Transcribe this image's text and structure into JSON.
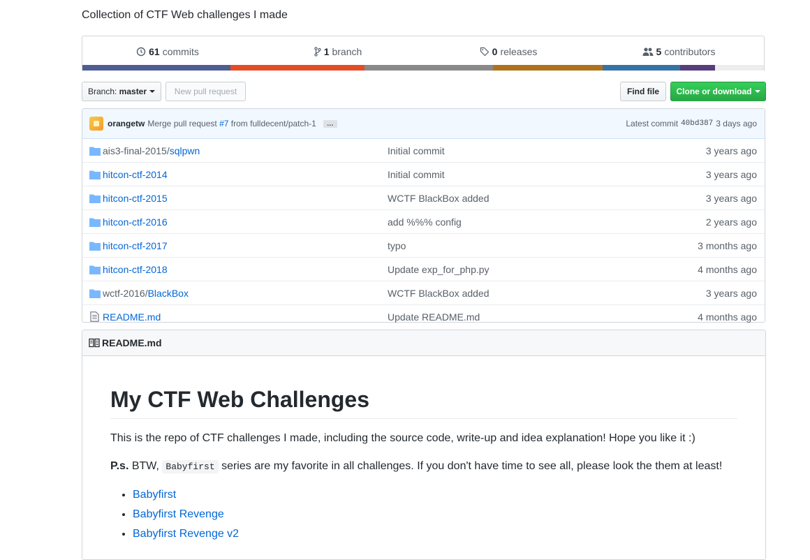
{
  "repo": {
    "description": "Collection of CTF Web challenges I made"
  },
  "stats": {
    "commits": {
      "count": "61",
      "label": "commits"
    },
    "branches": {
      "count": "1",
      "label": "branch"
    },
    "releases": {
      "count": "0",
      "label": "releases"
    },
    "contributors": {
      "count": "5",
      "label": "contributors"
    }
  },
  "language_colors": [
    "#4F5D95",
    "#e34c26",
    "#89898a",
    "#b07219",
    "#3572A5",
    "#563d7c",
    "#ededed"
  ],
  "toolbar": {
    "branch_prefix": "Branch:",
    "branch_name": "master",
    "new_pull_request": "New pull request",
    "find_file": "Find file",
    "clone_download": "Clone or download"
  },
  "latest_commit": {
    "author": "orangetw",
    "message_prefix": "Merge pull request",
    "pr_number": "#7",
    "message_suffix": "from fulldecent/patch-1",
    "ellipsis": "…",
    "latest_label": "Latest commit",
    "sha": "40bd387",
    "age": "3 days ago"
  },
  "files": [
    {
      "type": "dir",
      "path": "ais3-final-2015/",
      "name": "sqlpwn",
      "message": "Initial commit",
      "age": "3 years ago"
    },
    {
      "type": "dir",
      "path": "",
      "name": "hitcon-ctf-2014",
      "message": "Initial commit",
      "age": "3 years ago"
    },
    {
      "type": "dir",
      "path": "",
      "name": "hitcon-ctf-2015",
      "message": "WCTF BlackBox added",
      "age": "3 years ago"
    },
    {
      "type": "dir",
      "path": "",
      "name": "hitcon-ctf-2016",
      "message": "add %%% config",
      "age": "2 years ago"
    },
    {
      "type": "dir",
      "path": "",
      "name": "hitcon-ctf-2017",
      "message": "typo",
      "age": "3 months ago"
    },
    {
      "type": "dir",
      "path": "",
      "name": "hitcon-ctf-2018",
      "message": "Update exp_for_php.py",
      "age": "4 months ago"
    },
    {
      "type": "dir",
      "path": "wctf-2016/",
      "name": "BlackBox",
      "message": "WCTF BlackBox added",
      "age": "3 years ago"
    },
    {
      "type": "file",
      "path": "",
      "name": "README.md",
      "message": "Update README.md",
      "age": "4 months ago"
    }
  ],
  "readme": {
    "header": "README.md",
    "title": "My CTF Web Challenges",
    "intro": "This is the repo of CTF challenges I made, including the source code, write-up and idea explanation! Hope you like it :)",
    "ps_label": "P.s.",
    "ps_before": " BTW, ",
    "ps_code": "Babyfirst",
    "ps_after": " series are my favorite in all challenges. If you don't have time to see all, please look the them at least!",
    "links": [
      "Babyfirst",
      "Babyfirst Revenge",
      "Babyfirst Revenge v2"
    ]
  }
}
